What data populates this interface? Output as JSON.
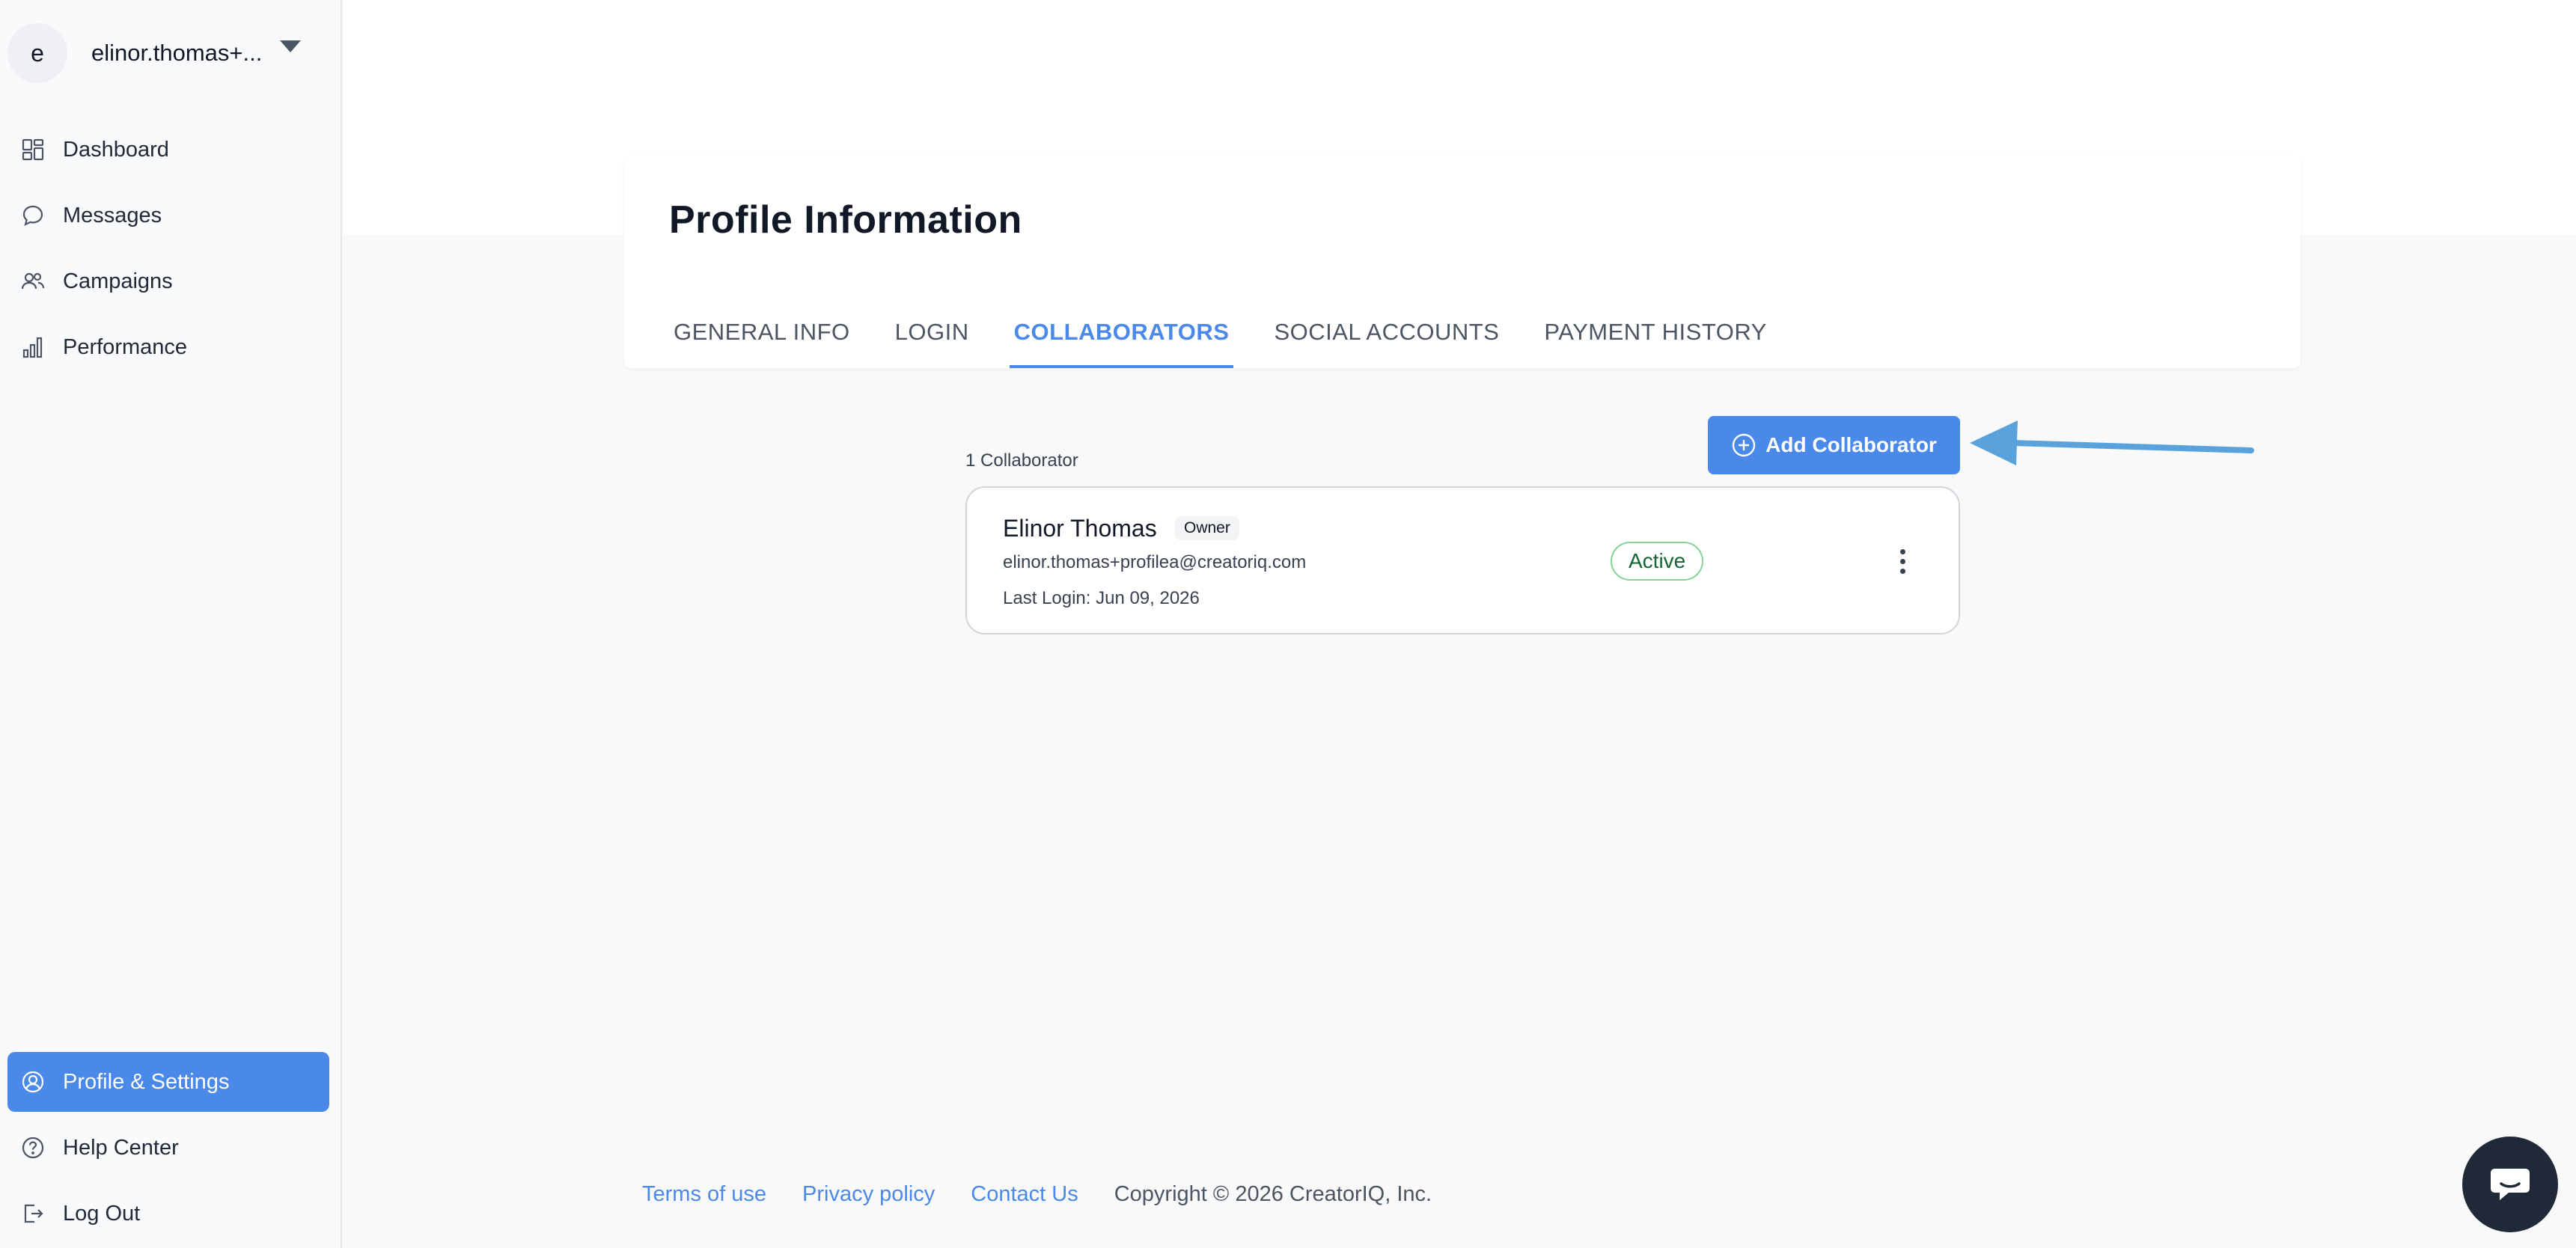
{
  "user": {
    "avatar_initial": "e",
    "display_name": "elinor.thomas+..."
  },
  "sidebar": {
    "items": [
      {
        "label": "Dashboard",
        "icon": "dashboard-icon"
      },
      {
        "label": "Messages",
        "icon": "chat-bubble-icon"
      },
      {
        "label": "Campaigns",
        "icon": "users-icon"
      },
      {
        "label": "Performance",
        "icon": "bar-chart-icon"
      }
    ],
    "bottom_items": [
      {
        "label": "Profile & Settings",
        "icon": "user-circle-icon",
        "active": true
      },
      {
        "label": "Help Center",
        "icon": "question-circle-icon"
      },
      {
        "label": "Log Out",
        "icon": "logout-icon"
      }
    ]
  },
  "main": {
    "title": "Profile Information",
    "tabs": [
      {
        "label": "GENERAL INFO"
      },
      {
        "label": "LOGIN"
      },
      {
        "label": "COLLABORATORS",
        "active": true
      },
      {
        "label": "SOCIAL ACCOUNTS"
      },
      {
        "label": "PAYMENT HISTORY"
      }
    ],
    "collaborator_count": "1 Collaborator",
    "add_button_label": "Add Collaborator",
    "collaborator": {
      "name": "Elinor Thomas",
      "role": "Owner",
      "email": "elinor.thomas+profilea@creatoriq.com",
      "last_login": "Last Login: Jun 09, 2026",
      "status": "Active"
    }
  },
  "footer": {
    "terms": "Terms of use",
    "privacy": "Privacy policy",
    "contact": "Contact Us",
    "copyright": "Copyright © 2026 CreatorIQ, Inc."
  },
  "colors": {
    "accent": "#4a89e8",
    "status_active": "#166534",
    "annotation_arrow": "#5aa2dc"
  }
}
